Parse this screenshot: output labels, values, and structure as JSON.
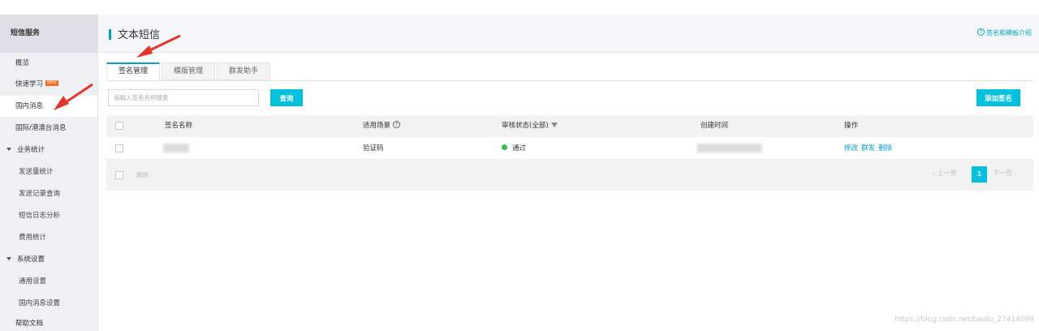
{
  "sidebar": {
    "header": "短信服务",
    "items": [
      {
        "label": "概览"
      },
      {
        "label": "快速学习",
        "badge": "NEW"
      },
      {
        "label": "国内消息"
      },
      {
        "label": "国际/港澳台消息"
      }
    ],
    "groups": [
      {
        "label": "业务统计",
        "children": [
          "发送量统计",
          "发送记录查询",
          "短信日志分析",
          "费用统计"
        ]
      },
      {
        "label": "系统设置",
        "children": [
          "通用设置",
          "国内消息设置"
        ]
      }
    ],
    "footer_item": "帮助文档"
  },
  "header": {
    "title": "文本短信",
    "help_link": "签名和模板介绍",
    "help_icon": "question-circle-icon"
  },
  "tabs": [
    {
      "label": "签名管理",
      "active": true
    },
    {
      "label": "模版管理",
      "active": false
    },
    {
      "label": "群发助手",
      "active": false
    }
  ],
  "search": {
    "placeholder": "请输入签名名称搜索",
    "query_label": "查询"
  },
  "add_button": "添加签名",
  "table": {
    "columns": [
      "签名名称",
      "适用场景",
      "审核状态(全部)",
      "创建时间",
      "操作"
    ],
    "rows": [
      {
        "scene": "验证码",
        "status": "通过",
        "status_color": "#2ebe4e",
        "actions": [
          "修改",
          "群发",
          "删除"
        ]
      }
    ],
    "bulk_delete": "删除"
  },
  "pagination": {
    "prev": "上一页",
    "current": "1",
    "next": "下一页"
  },
  "colors": {
    "accent": "#00a2ca",
    "button": "#00c1de",
    "annotation_arrow": "#e5352b"
  },
  "watermark": "https://blog.csdn.net/baidu_27414099"
}
